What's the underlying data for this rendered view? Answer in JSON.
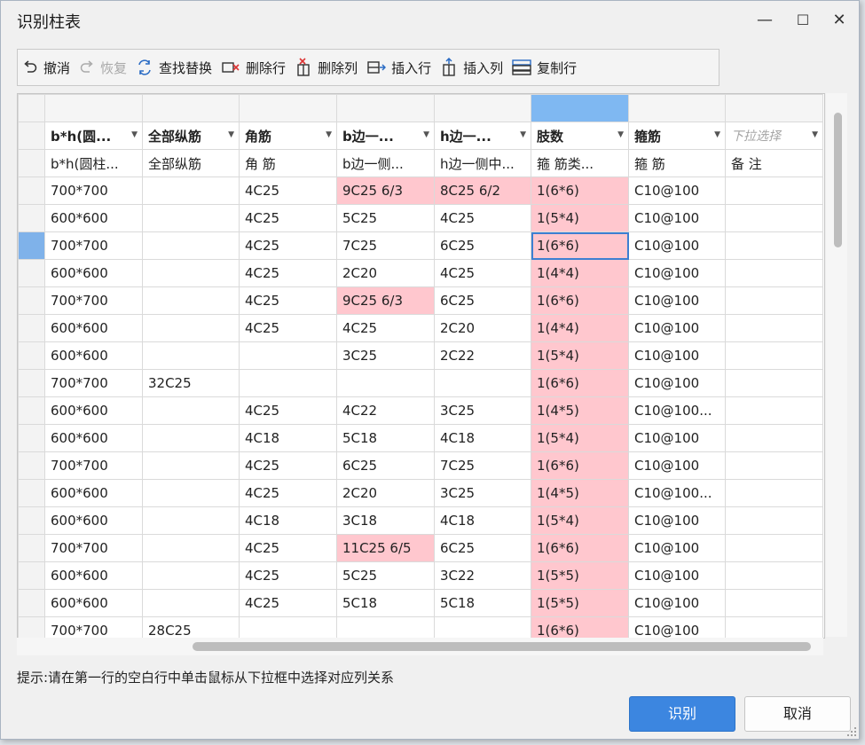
{
  "window": {
    "title": "识别柱表",
    "minimize": "—",
    "maximize": "☐",
    "close": "✕"
  },
  "toolbar": {
    "undo": "撤消",
    "redo": "恢复",
    "find_replace": "查找替换",
    "delete_row": "删除行",
    "delete_col": "删除列",
    "insert_row": "插入行",
    "insert_col": "插入列",
    "copy_row": "复制行"
  },
  "grid": {
    "header_dropdowns": [
      "b*h(圆...",
      "全部纵筋",
      "角筋",
      "b边一...",
      "h边一...",
      "肢数",
      "箍筋",
      "下拉选择"
    ],
    "source_headers": [
      "b*h(圆柱...",
      "全部纵筋",
      "角  筋",
      "b边一侧...",
      "h边一侧中...",
      "箍  筋类...",
      "箍    筋",
      "备    注"
    ],
    "rows": [
      [
        "700*700",
        "",
        "4C25",
        "9C25 6/3",
        "8C25 6/2",
        "1(6*6)",
        "C10@100",
        ""
      ],
      [
        "600*600",
        "",
        "4C25",
        "5C25",
        "4C25",
        "1(5*4)",
        "C10@100",
        ""
      ],
      [
        "700*700",
        "",
        "4C25",
        "7C25",
        "6C25",
        "1(6*6)",
        "C10@100",
        ""
      ],
      [
        "600*600",
        "",
        "4C25",
        "2C20",
        "4C25",
        "1(4*4)",
        "C10@100",
        ""
      ],
      [
        "700*700",
        "",
        "4C25",
        "9C25 6/3",
        "6C25",
        "1(6*6)",
        "C10@100",
        ""
      ],
      [
        "600*600",
        "",
        "4C25",
        "4C25",
        "2C20",
        "1(4*4)",
        "C10@100",
        ""
      ],
      [
        "600*600",
        "",
        "",
        "3C25",
        "2C22",
        "1(5*4)",
        "C10@100",
        ""
      ],
      [
        "700*700",
        "32C25",
        "",
        "",
        "",
        "1(6*6)",
        "C10@100",
        ""
      ],
      [
        "600*600",
        "",
        "4C25",
        "4C22",
        "3C25",
        "1(4*5)",
        "C10@100...",
        ""
      ],
      [
        "600*600",
        "",
        "4C18",
        "5C18",
        "4C18",
        "1(5*4)",
        "C10@100",
        ""
      ],
      [
        "700*700",
        "",
        "4C25",
        "6C25",
        "7C25",
        "1(6*6)",
        "C10@100",
        ""
      ],
      [
        "600*600",
        "",
        "4C25",
        "2C20",
        "3C25",
        "1(4*5)",
        "C10@100...",
        ""
      ],
      [
        "600*600",
        "",
        "4C18",
        "3C18",
        "4C18",
        "1(5*4)",
        "C10@100",
        ""
      ],
      [
        "700*700",
        "",
        "4C25",
        "11C25 6/5",
        "6C25",
        "1(6*6)",
        "C10@100",
        ""
      ],
      [
        "600*600",
        "",
        "4C25",
        "5C25",
        "3C22",
        "1(5*5)",
        "C10@100",
        ""
      ],
      [
        "600*600",
        "",
        "4C25",
        "5C18",
        "5C18",
        "1(5*5)",
        "C10@100",
        ""
      ],
      [
        "700*700",
        "28C25",
        "",
        "",
        "",
        "1(6*6)",
        "C10@100",
        ""
      ]
    ],
    "highlighted_cells": [
      [
        0,
        3
      ],
      [
        0,
        4
      ],
      [
        4,
        3
      ],
      [
        13,
        3
      ]
    ],
    "highlight_color": "#ffc7ce",
    "selected_row": 2,
    "current_cell": [
      2,
      5
    ]
  },
  "hint": "提示:请在第一行的空白行中单击鼠标从下拉框中选择对应列关系",
  "buttons": {
    "ok": "识别",
    "cancel": "取消"
  },
  "colors": {
    "accent": "#3c86e0",
    "selection": "#7fb8f2"
  }
}
